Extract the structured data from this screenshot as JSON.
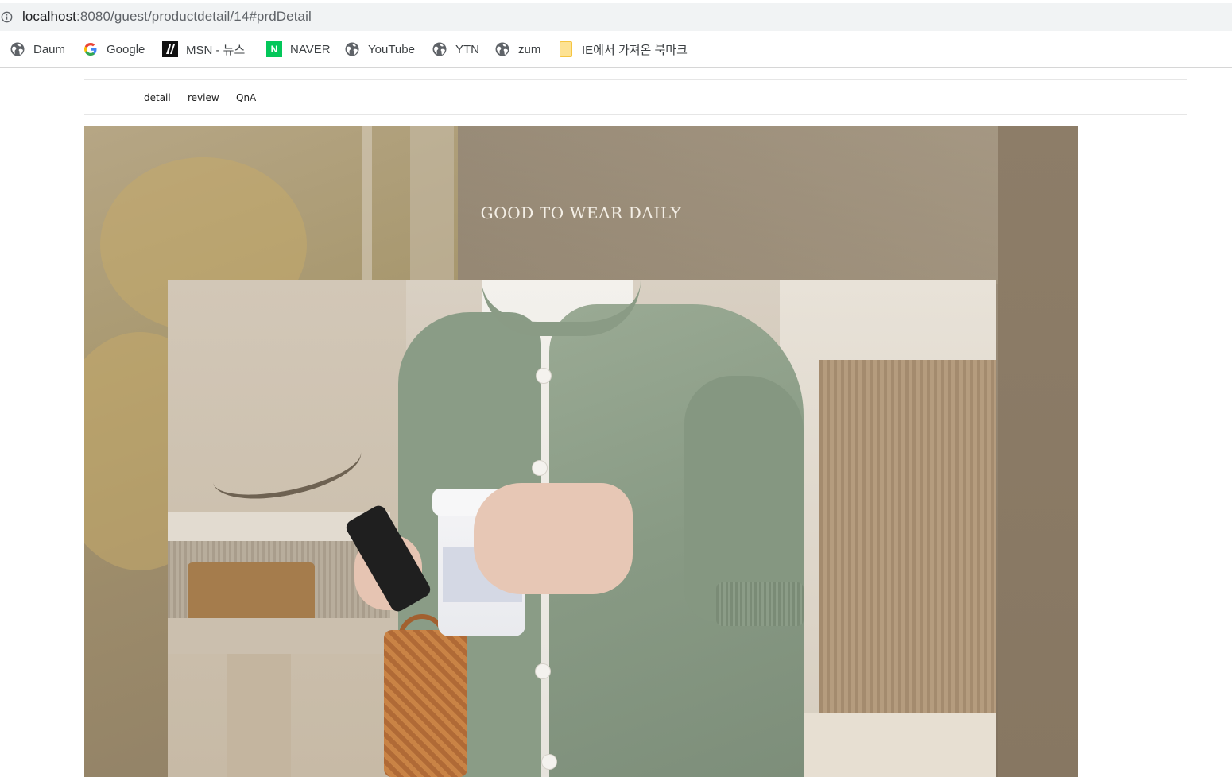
{
  "browser": {
    "url_host": "localhost",
    "url_path": ":8080/guest/productdetail/14#prdDetail",
    "bookmarks": [
      {
        "label": "Daum",
        "icon": "globe-icon"
      },
      {
        "label": "Google",
        "icon": "google-icon"
      },
      {
        "label": "MSN - 뉴스",
        "icon": "msn-icon"
      },
      {
        "label": "NAVER",
        "icon": "naver-icon"
      },
      {
        "label": "YouTube",
        "icon": "globe-icon"
      },
      {
        "label": "YTN",
        "icon": "globe-icon"
      },
      {
        "label": "zum",
        "icon": "globe-icon"
      },
      {
        "label": "IE에서 가져온 북마크",
        "icon": "folder-icon"
      }
    ],
    "naver_icon_letter": "N"
  },
  "product_tabs": [
    {
      "label": "detail"
    },
    {
      "label": "review"
    },
    {
      "label": "QnA"
    }
  ],
  "detail_image": {
    "headline": "GOOD TO WEAR DAILY"
  }
}
